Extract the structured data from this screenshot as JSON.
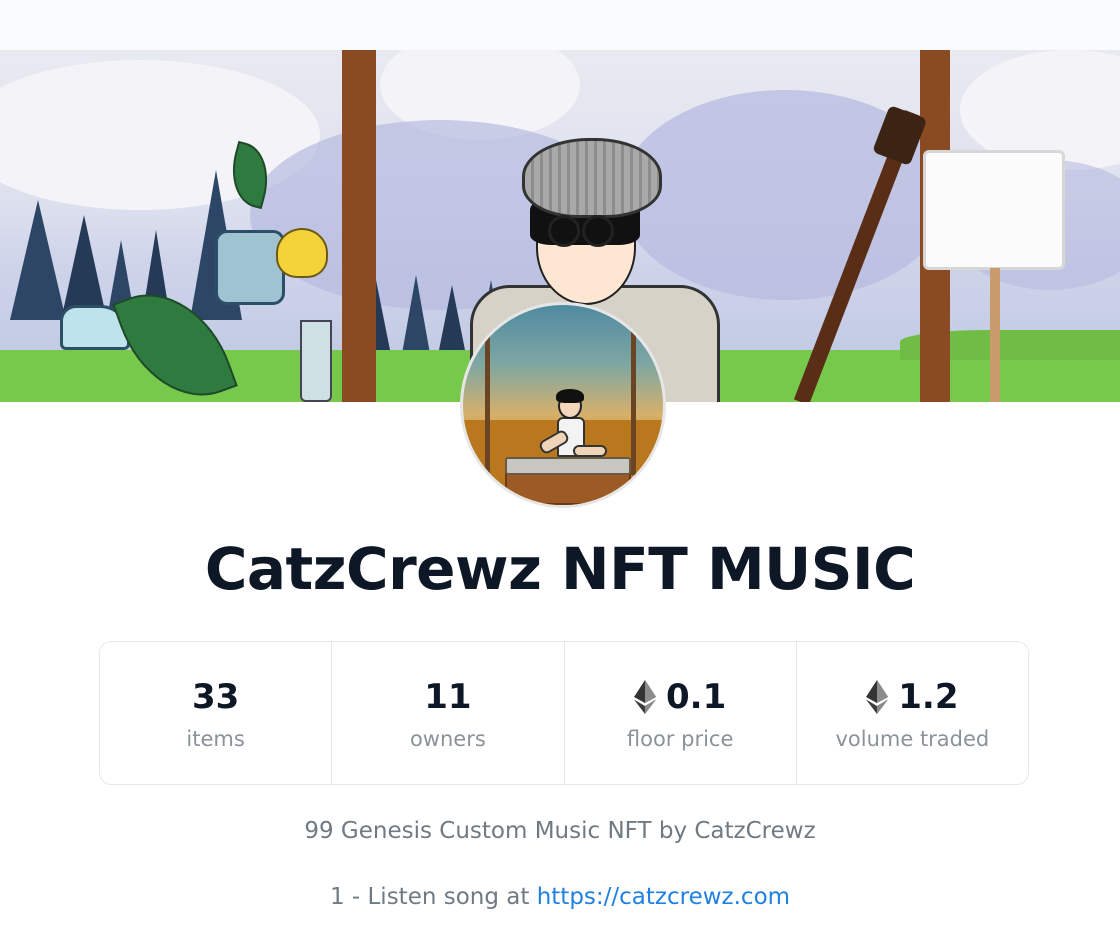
{
  "collection": {
    "name": "CatzCrewz NFT MUSIC",
    "description_line1": "99 Genesis Custom Music NFT by CatzCrewz",
    "description_line2_prefix": "1 - Listen song at ",
    "description_link": "https://catzcrewz.com"
  },
  "stats": [
    {
      "value": "33",
      "label": "items",
      "icon": ""
    },
    {
      "value": "11",
      "label": "owners",
      "icon": ""
    },
    {
      "value": "0.1",
      "label": "floor price",
      "icon": "ethereum-icon"
    },
    {
      "value": "1.2",
      "label": "volume traded",
      "icon": "ethereum-icon"
    }
  ],
  "colors": {
    "title": "#0e1726",
    "label": "#8a939b",
    "link": "#2081e2",
    "border": "#e5e8eb"
  }
}
